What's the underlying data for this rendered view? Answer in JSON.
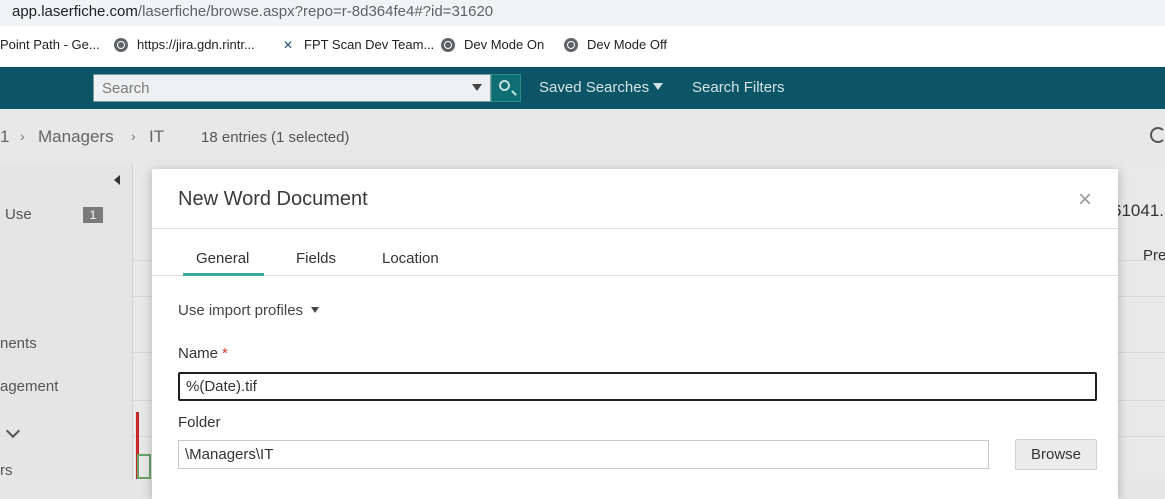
{
  "browser": {
    "url_host": "app.laserfiche.com",
    "url_path": "/laserfiche/browse.aspx?repo=r-8d364fe4#?id=31620",
    "bookmarks": [
      {
        "label": "Point Path - Ge...",
        "icon": "none"
      },
      {
        "label": "https://jira.gdn.rintr...",
        "icon": "globe-icon"
      },
      {
        "label": "FPT Scan Dev Team...",
        "icon": "hp-icon"
      },
      {
        "label": "Dev Mode On",
        "icon": "globe-icon"
      },
      {
        "label": "Dev Mode Off",
        "icon": "globe-icon"
      }
    ]
  },
  "header": {
    "search_placeholder": "Search",
    "saved_searches": "Saved Searches",
    "search_filters": "Search Filters",
    "bar_color": "#0b5566"
  },
  "breadcrumb": {
    "items": [
      "1",
      "Managers",
      "IT"
    ],
    "entries": "18 entries (1 selected)"
  },
  "left_pane": {
    "items": [
      {
        "label": "Use",
        "badge": "1"
      },
      {
        "label": "nents"
      },
      {
        "label": "agement"
      },
      {
        "label": "rs"
      }
    ]
  },
  "background": {
    "peek_number": "61041.",
    "peek_column": "Pre"
  },
  "dialog": {
    "title": "New Word Document",
    "close": "×",
    "tabs": [
      "General",
      "Fields",
      "Location"
    ],
    "active_tab": "General",
    "import_profiles": "Use import profiles",
    "name_label": "Name",
    "required_mark": "*",
    "name_value": "%(Date).tif",
    "folder_label": "Folder",
    "folder_value": "\\Managers\\IT",
    "browse_label": "Browse",
    "accent_color": "#3aa99f"
  }
}
